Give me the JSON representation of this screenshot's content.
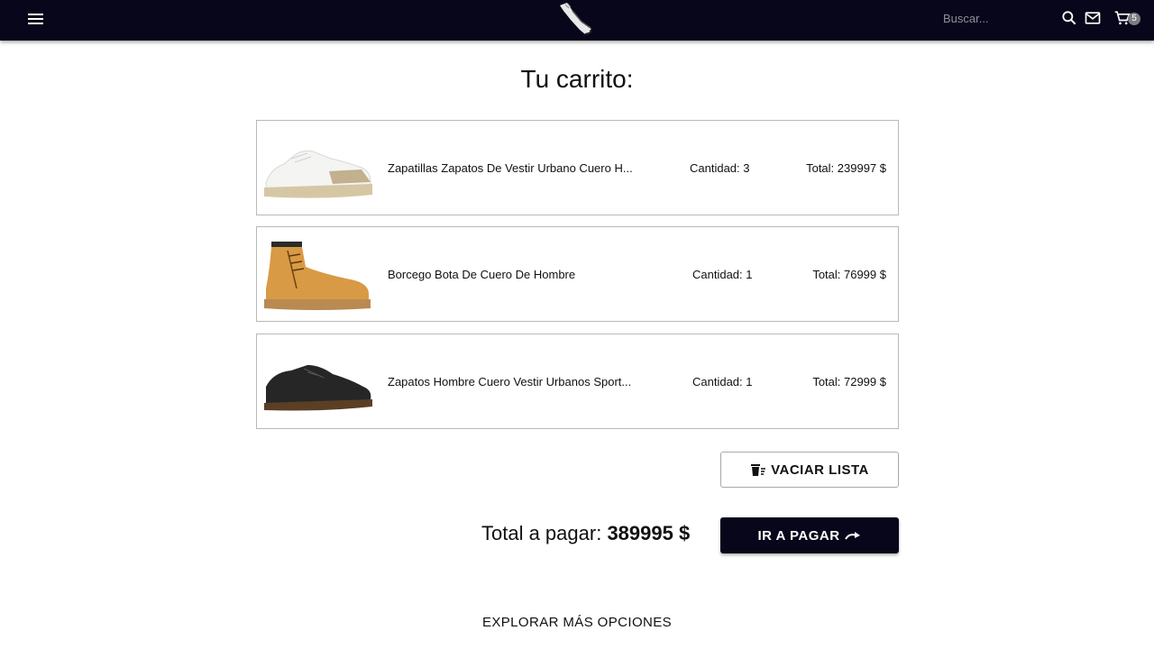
{
  "header": {
    "search_placeholder": "Buscar...",
    "cart_count": "5"
  },
  "page": {
    "title": "Tu carrito:"
  },
  "cart": {
    "items": [
      {
        "name": "Zapatillas Zapatos De Vestir Urbano Cuero H...",
        "quantity_label": "Cantidad: 3",
        "total_label": "Total: 239997 $",
        "image": "white-sneaker"
      },
      {
        "name": "Borcego Bota De Cuero De Hombre",
        "quantity_label": "Cantidad: 1",
        "total_label": "Total: 76999 $",
        "image": "tan-boot"
      },
      {
        "name": "Zapatos Hombre Cuero Vestir Urbanos Sport...",
        "quantity_label": "Cantidad: 1",
        "total_label": "Total: 72999 $",
        "image": "black-dress-shoe"
      }
    ],
    "empty_button_label": "VACIAR LISTA",
    "total_prefix": "Total a pagar: ",
    "total_value": "389995 $",
    "pay_button_label": "IR A PAGAR"
  },
  "footer": {
    "explore_label": "EXPLORAR MÁS OPCIONES"
  },
  "colors": {
    "header_bg": "#07061a",
    "pay_button_bg": "#07061a",
    "border": "#b9b9b9"
  },
  "icons": [
    "menu-icon",
    "sneaker-logo-icon",
    "search-icon",
    "mail-icon",
    "cart-icon",
    "trash-icon",
    "redo-arrow-icon"
  ]
}
